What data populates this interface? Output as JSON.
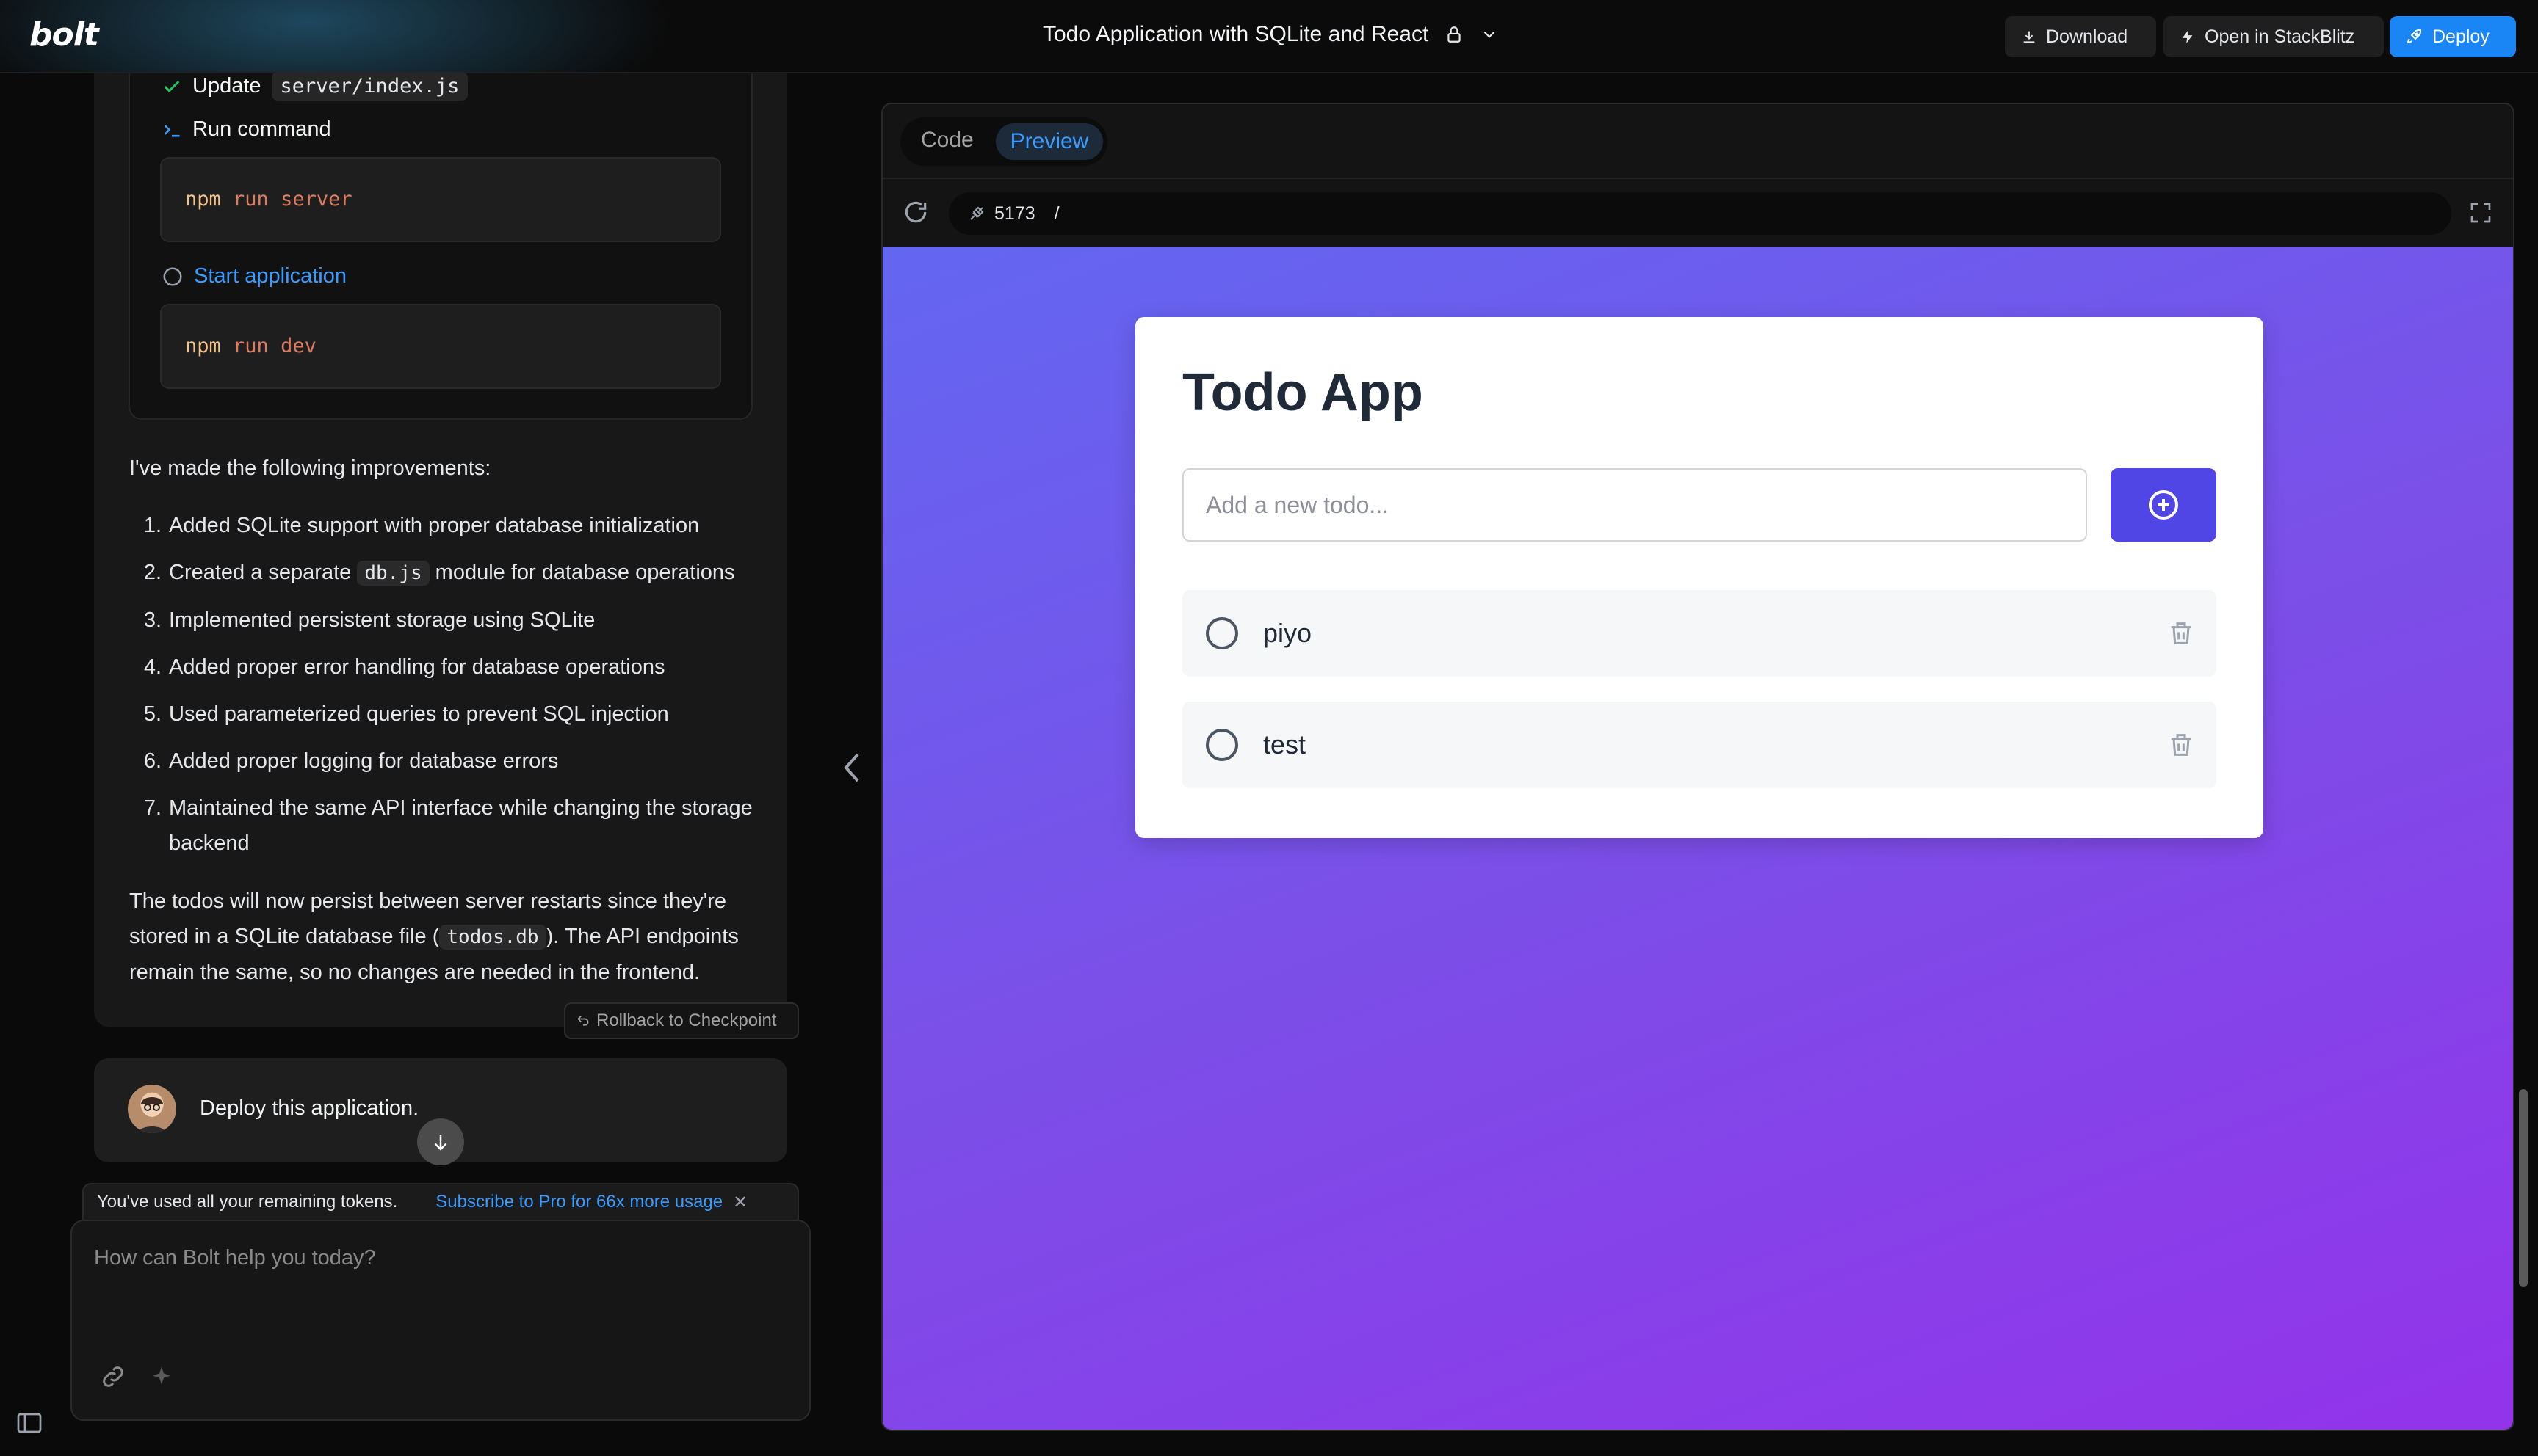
{
  "app": {
    "logo": "bolt",
    "project_title": "Todo Application with SQLite and React"
  },
  "toolbar": {
    "download_label": "Download",
    "stackblitz_label": "Open in StackBlitz",
    "deploy_label": "Deploy"
  },
  "steps": [
    {
      "status": "done",
      "label": "Update",
      "file": "server/index.js"
    },
    {
      "status": "command",
      "label": "Run command",
      "command_bin": "npm",
      "command_kw": "run",
      "command_arg": "server"
    },
    {
      "status": "pending",
      "label": "Start application",
      "command_bin": "npm",
      "command_kw": "run",
      "command_arg": "dev"
    }
  ],
  "message": {
    "intro": "I've made the following improvements:",
    "improvements": [
      {
        "num": "1.",
        "before": "Added SQLite support with proper database initialization",
        "code": "",
        "after": ""
      },
      {
        "num": "2.",
        "before": "Created a separate ",
        "code": "db.js",
        "after": " module for database operations"
      },
      {
        "num": "3.",
        "before": "Implemented persistent storage using SQLite",
        "code": "",
        "after": ""
      },
      {
        "num": "4.",
        "before": "Added proper error handling for database operations",
        "code": "",
        "after": ""
      },
      {
        "num": "5.",
        "before": "Used parameterized queries to prevent SQL injection",
        "code": "",
        "after": ""
      },
      {
        "num": "6.",
        "before": "Added proper logging for database errors",
        "code": "",
        "after": ""
      },
      {
        "num": "7.",
        "before": "Maintained the same API interface while changing the storage backend",
        "code": "",
        "after": ""
      }
    ],
    "summary_before": "The todos will now persist between server restarts since they're stored in a SQLite database file (",
    "summary_code": "todos.db",
    "summary_after": "). The API endpoints remain the same, so no changes are needed in the frontend."
  },
  "rollback_label": "Rollback to Checkpoint",
  "user_message": "Deploy this application.",
  "token_banner": {
    "text": "You've used all your remaining tokens.",
    "link": "Subscribe to Pro for 66x more usage"
  },
  "prompt": {
    "placeholder": "How can Bolt help you today?"
  },
  "workbench": {
    "tab_code": "Code",
    "tab_preview": "Preview",
    "port": "5173",
    "path": "/"
  },
  "todo_app": {
    "title": "Todo App",
    "input_placeholder": "Add a new todo...",
    "items": [
      {
        "text": "piyo",
        "completed": false
      },
      {
        "text": "test",
        "completed": false
      }
    ]
  },
  "icons": {
    "step_done": "check-icon",
    "step_command": "terminal-icon",
    "step_pending": "circle-icon",
    "add": "plus-circle-icon",
    "delete": "trash-icon"
  },
  "colors": {
    "accent": "#1a86f5",
    "link": "#3b9cff",
    "todo_button": "#4f46e5",
    "preview_gradient_start": "#6366f1",
    "preview_gradient_end": "#9333ea"
  }
}
